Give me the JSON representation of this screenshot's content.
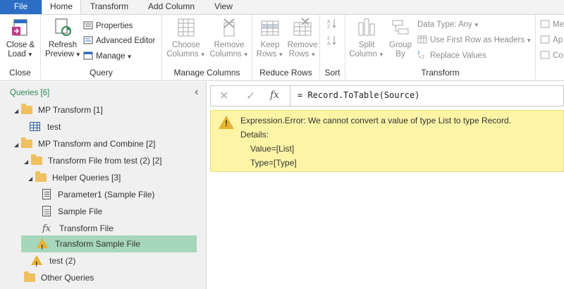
{
  "tabs": {
    "file": "File",
    "home": "Home",
    "transform": "Transform",
    "add_column": "Add Column",
    "view": "View"
  },
  "ribbon": {
    "close": {
      "label1": "Close &",
      "label2": "Load",
      "group": "Close"
    },
    "query": {
      "refresh1": "Refresh",
      "refresh2": "Preview",
      "properties": "Properties",
      "advanced_editor": "Advanced Editor",
      "manage": "Manage",
      "group": "Query"
    },
    "manage_columns": {
      "choose1": "Choose",
      "choose2": "Columns",
      "remove1": "Remove",
      "remove2": "Columns",
      "group": "Manage Columns"
    },
    "reduce_rows": {
      "keep1": "Keep",
      "keep2": "Rows",
      "remove1": "Remove",
      "remove2": "Rows",
      "group": "Reduce Rows"
    },
    "sort": {
      "group": "Sort"
    },
    "transform": {
      "split1": "Split",
      "split2": "Column",
      "group1": "Group",
      "group2": "By",
      "data_type": "Data Type: Any",
      "first_row": "Use First Row as Headers",
      "replace": "Replace Values",
      "group": "Transform"
    },
    "more": {
      "me": "Me",
      "ap": "Ap",
      "co": "Co"
    }
  },
  "queries": {
    "header": "Queries [6]",
    "items": [
      {
        "label": "MP Transform [1]"
      },
      {
        "label": "test"
      },
      {
        "label": "MP Transform and Combine [2]"
      },
      {
        "label": "Transform File from test (2) [2]"
      },
      {
        "label": "Helper Queries [3]"
      },
      {
        "label": "Parameter1 (Sample File)"
      },
      {
        "label": "Sample File"
      },
      {
        "label": "Transform File"
      },
      {
        "label": "Transform Sample File"
      },
      {
        "label": "test (2)"
      },
      {
        "label": "Other Queries"
      }
    ]
  },
  "formula_bar": {
    "cancel": "✕",
    "accept": "✓",
    "fx": "fx",
    "formula": "= Record.ToTable(Source)"
  },
  "error": {
    "message": "Expression.Error: We cannot convert a value of type List to type Record.",
    "details_label": "Details:",
    "value_line": "Value=[List]",
    "type_line": "Type=[Type]"
  },
  "colors": {
    "file_tab": "#2b6ec4",
    "selected_row": "#a6d7ba",
    "error_bg": "#fdf4a6",
    "warning": "#e8b233"
  }
}
